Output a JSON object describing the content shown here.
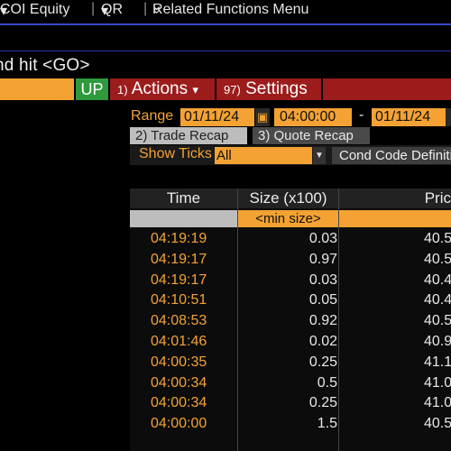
{
  "menu": {
    "security": "COI Equity",
    "qr": "QR",
    "related": "Related Functions Menu",
    "caret": "▾",
    "double_chevron": "»"
  },
  "command_prompt": "nd hit <GO>",
  "toolbar": {
    "up_label": "UP",
    "actions_num": "1)",
    "actions_label": "Actions",
    "actions_caret": "▾",
    "settings_num": "97)",
    "settings_label": "Settings"
  },
  "range": {
    "label": "Range",
    "start_date": "01/11/24",
    "start_time": "04:00:00",
    "separator": "-",
    "end_date": "01/11/24"
  },
  "tabs": [
    {
      "label": "2) Trade Recap",
      "active": true
    },
    {
      "label": "3) Quote Recap",
      "active": false
    }
  ],
  "filters": {
    "show_ticks_label": "Show Ticks",
    "show_ticks_value": "All",
    "cond_code_label": "Cond Code Definiti"
  },
  "table": {
    "headers": {
      "time": "Time",
      "size": "Size (x100)",
      "price": "Pric"
    },
    "size_filter": "<min size>",
    "rows": [
      {
        "time": "04:19:19",
        "size": "0.03",
        "price": "40.5"
      },
      {
        "time": "04:19:17",
        "size": "0.97",
        "price": "40.5"
      },
      {
        "time": "04:19:17",
        "size": "0.03",
        "price": "40.4"
      },
      {
        "time": "04:10:51",
        "size": "0.05",
        "price": "40.4"
      },
      {
        "time": "04:08:53",
        "size": "0.92",
        "price": "40.5"
      },
      {
        "time": "04:01:46",
        "size": "0.02",
        "price": "40.9"
      },
      {
        "time": "04:00:35",
        "size": "0.25",
        "price": "41.1"
      },
      {
        "time": "04:00:34",
        "size": "0.5",
        "price": "41.0"
      },
      {
        "time": "04:00:34",
        "size": "0.25",
        "price": "41.0"
      },
      {
        "time": "04:00:00",
        "size": "1.5",
        "price": "40.5"
      }
    ]
  },
  "colors": {
    "accent_orange": "#f4a233",
    "up_green": "#2e9a3c",
    "action_red": "#9c1c1c",
    "rule_blue": "#3a49c8"
  }
}
